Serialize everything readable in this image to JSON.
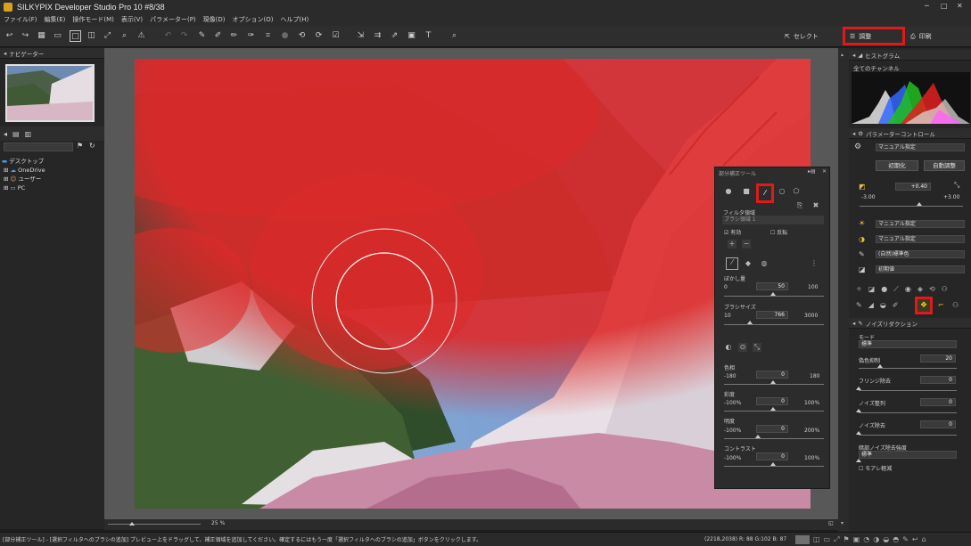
{
  "window": {
    "title": "SILKYPIX Developer Studio Pro 10   #8/38",
    "controls": [
      "─",
      "□",
      "✕"
    ]
  },
  "menu": [
    "ファイル(F)",
    "編集(E)",
    "操作モード(M)",
    "表示(V)",
    "パラメーター(P)",
    "現像(D)",
    "オプション(O)",
    "ヘルプ(H)"
  ],
  "modes": {
    "select": "セレクト",
    "adjust": "調整",
    "print": "印刷"
  },
  "navigator": {
    "title": "ナビゲーター"
  },
  "tree": {
    "items": [
      "デスクトップ",
      "OneDrive",
      "ユーザー",
      "PC"
    ]
  },
  "histogram": {
    "title": "ヒストグラム",
    "channel": "全てのチャンネル"
  },
  "param": {
    "title": "パラメーターコントロール",
    "manual": "マニュアル指定",
    "reset": "初期化",
    "auto": "自動調整",
    "exposure": "+0.40",
    "exp_min": "-3.00",
    "exp_max": "+3.00",
    "wb": "マニュアル指定",
    "tone": "マニュアル指定",
    "color": "(自然)標準色",
    "sharp": "初期値"
  },
  "noise": {
    "title": "ノイズリダクション",
    "mode_label": "モード",
    "mode_value": "標準",
    "suppress_label": "偽色抑制",
    "suppress_value": "20",
    "fringe_label": "フリンジ除去",
    "fringe_value": "0",
    "reduce_label": "ノイズ整列",
    "reduce_value": "0",
    "remove_label": "ノイズ除去",
    "remove_value": "0",
    "edge_label": "暗部ノイズ除去強度",
    "edge_value": "標準",
    "moire_label": "モアレ軽減"
  },
  "filter_panel": {
    "title": "部分補正ツール",
    "region_label": "フィルタ領域",
    "region_name": "ブラシ領域 1",
    "enabled": "有効",
    "invert": "反転",
    "feather_label": "ぼかし量",
    "feather_min": "0",
    "feather_value": "50",
    "feather_max": "100",
    "size_label": "ブラシサイズ",
    "size_min": "10",
    "size_value": "766",
    "size_max": "3000",
    "hue_label": "色相",
    "hue_min": "-180",
    "hue_value": "0",
    "hue_max": "180",
    "sat_label": "彩度",
    "sat_min": "-100%",
    "sat_value": "0",
    "sat_max": "100%",
    "bright_label": "明度",
    "bright_min": "-100%",
    "bright_value": "0",
    "bright_max": "200%",
    "contrast_label": "コントラスト",
    "contrast_min": "-100%",
    "contrast_value": "0",
    "contrast_max": "100%"
  },
  "zoom": {
    "value": "25 %"
  },
  "status": {
    "message": "[部分補正ツール] - [選択フィルタへのブラシの追加] プレビュー上をドラッグして、補正領域を追加してください。確定するにはもう一度「選択フィルタへのブラシの追加」ボタンをクリックします。",
    "coords": "(2218,2038) R: 88 G:102 B: 87"
  },
  "colors": {
    "accent_red": "#e0191b",
    "mask_red": "#dd2a2a"
  }
}
